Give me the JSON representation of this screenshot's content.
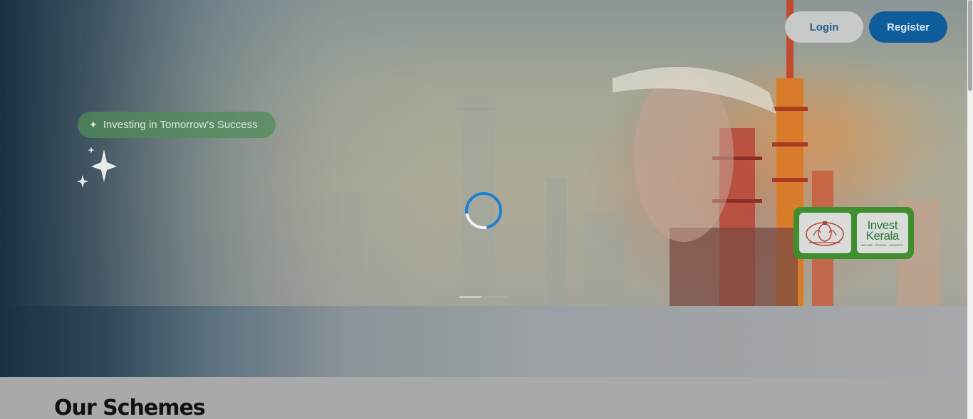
{
  "header": {
    "login_label": "Login",
    "register_label": "Register"
  },
  "hero": {
    "tagline": "Investing in Tomorrow's Success",
    "tagline_icon": "sparkle-icon",
    "loading_icon": "spinner-icon",
    "slides_total": 2,
    "active_slide": 1
  },
  "partner_logos": {
    "govt_emblem_icon": "kerala-emblem-icon",
    "invest_kerala_line1": "Invest",
    "invest_kerala_line2": "Kerala",
    "invest_kerala_tagline": "NATURE · PEOPLE · INDUSTRY"
  },
  "sections": {
    "schemes_title": "Our Schemes"
  },
  "colors": {
    "primary_blue": "#0f5c9d",
    "accent_green": "#3f8f2f",
    "spinner_blue": "#1d7fcf"
  }
}
